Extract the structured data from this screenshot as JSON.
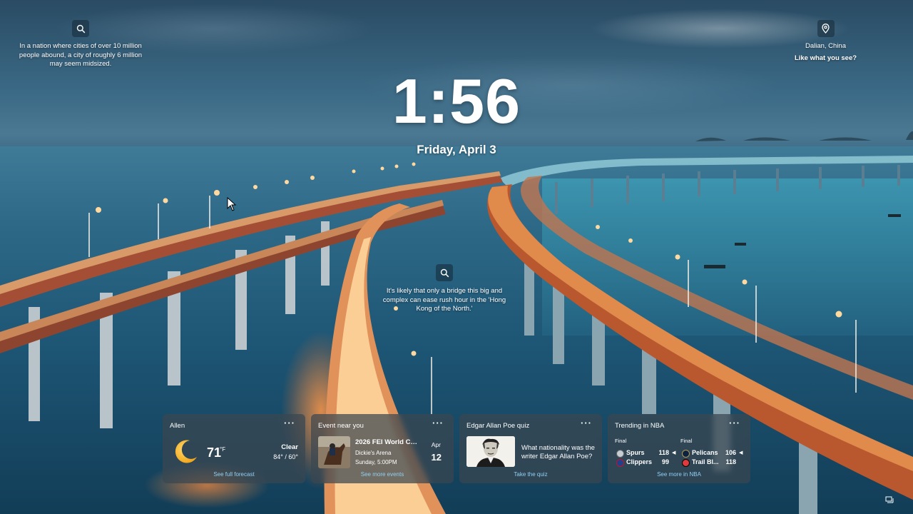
{
  "top_left": {
    "icon": "search-icon",
    "text": "In a nation where cities of over 10 million people abound, a city of roughly 6 million may seem midsized."
  },
  "top_right": {
    "icon": "location-pin-icon",
    "location": "Dalian, China",
    "like_prompt": "Like what you see?"
  },
  "clock": {
    "time": "1:56",
    "date": "Friday, April 3"
  },
  "middle_fact": {
    "icon": "search-icon",
    "text": "It's likely that only a bridge this big and complex can ease rush hour in the 'Hong Kong of the North.'"
  },
  "widgets": {
    "weather": {
      "title": "Allen",
      "more": "···",
      "icon": "moon-icon",
      "temperature": "71",
      "unit": "°F",
      "condition": "Clear",
      "range": "84° / 60°",
      "link": "See full forecast"
    },
    "event": {
      "title": "Event near you",
      "more": "···",
      "name": "2026 FEI World Cu...",
      "venue": "Dickie's Arena",
      "time": "Sunday, 5:00PM",
      "month": "Apr",
      "day": "12",
      "link": "See more events"
    },
    "quiz": {
      "title": "Edgar Allan Poe quiz",
      "more": "···",
      "question": "What nationality was the writer Edgar Allan Poe?",
      "link": "Take the quiz"
    },
    "nba": {
      "title": "Trending in NBA",
      "more": "···",
      "games": [
        {
          "status": "Final",
          "teams": [
            {
              "name": "Spurs",
              "score": "118",
              "winner": true
            },
            {
              "name": "Clippers",
              "score": "99",
              "winner": false
            }
          ]
        },
        {
          "status": "Final",
          "teams": [
            {
              "name": "Pelicans",
              "score": "106",
              "winner": true
            },
            {
              "name": "Trail Bl...",
              "score": "118",
              "winner": false
            }
          ]
        }
      ],
      "link": "See more in NBA"
    }
  }
}
